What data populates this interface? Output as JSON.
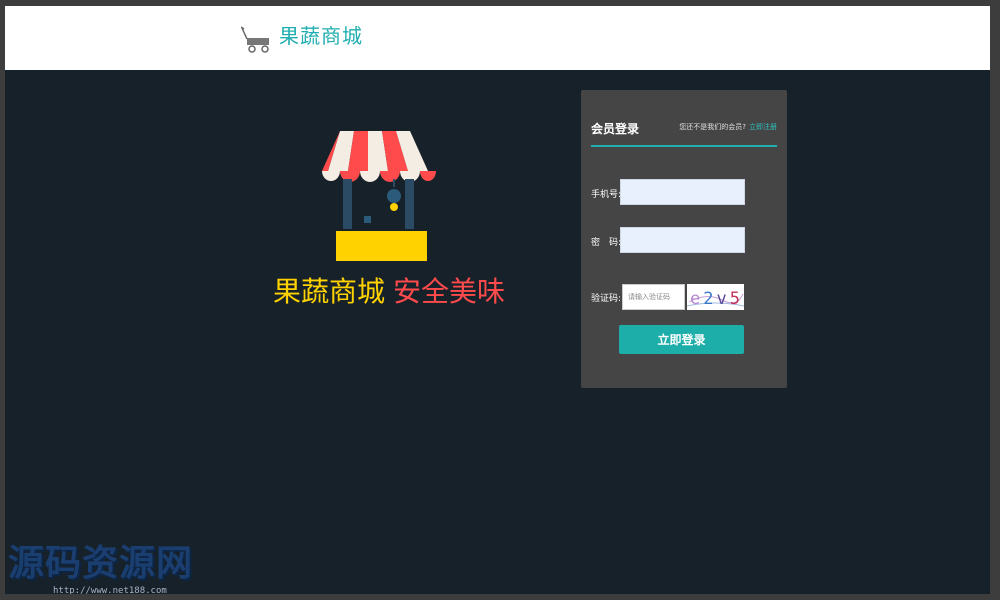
{
  "header": {
    "logo_icon": "cart-icon",
    "logo_text": "果蔬商城"
  },
  "hero": {
    "icon": "market-stall-icon",
    "slogan_part1": "果蔬商城",
    "slogan_part2": "安全美味"
  },
  "login": {
    "title": "会员登录",
    "hint_text": "您还不是我们的会员?",
    "register_link": "立即注册",
    "phone_label": "手机号:",
    "phone_value": "",
    "password_label": "密　码:",
    "password_value": "",
    "captcha_label": "验证码:",
    "captcha_placeholder": "请输入验证码",
    "captcha_text": "e2v5",
    "submit_label": "立即登录"
  },
  "watermark": {
    "text": "源码资源网",
    "url": "http://www.net188.com"
  },
  "colors": {
    "brand": "#20aeb0",
    "slogan_yellow": "#ffd200",
    "slogan_red": "#ff4b4b",
    "background": "#17212a",
    "login_panel": "#454545"
  }
}
